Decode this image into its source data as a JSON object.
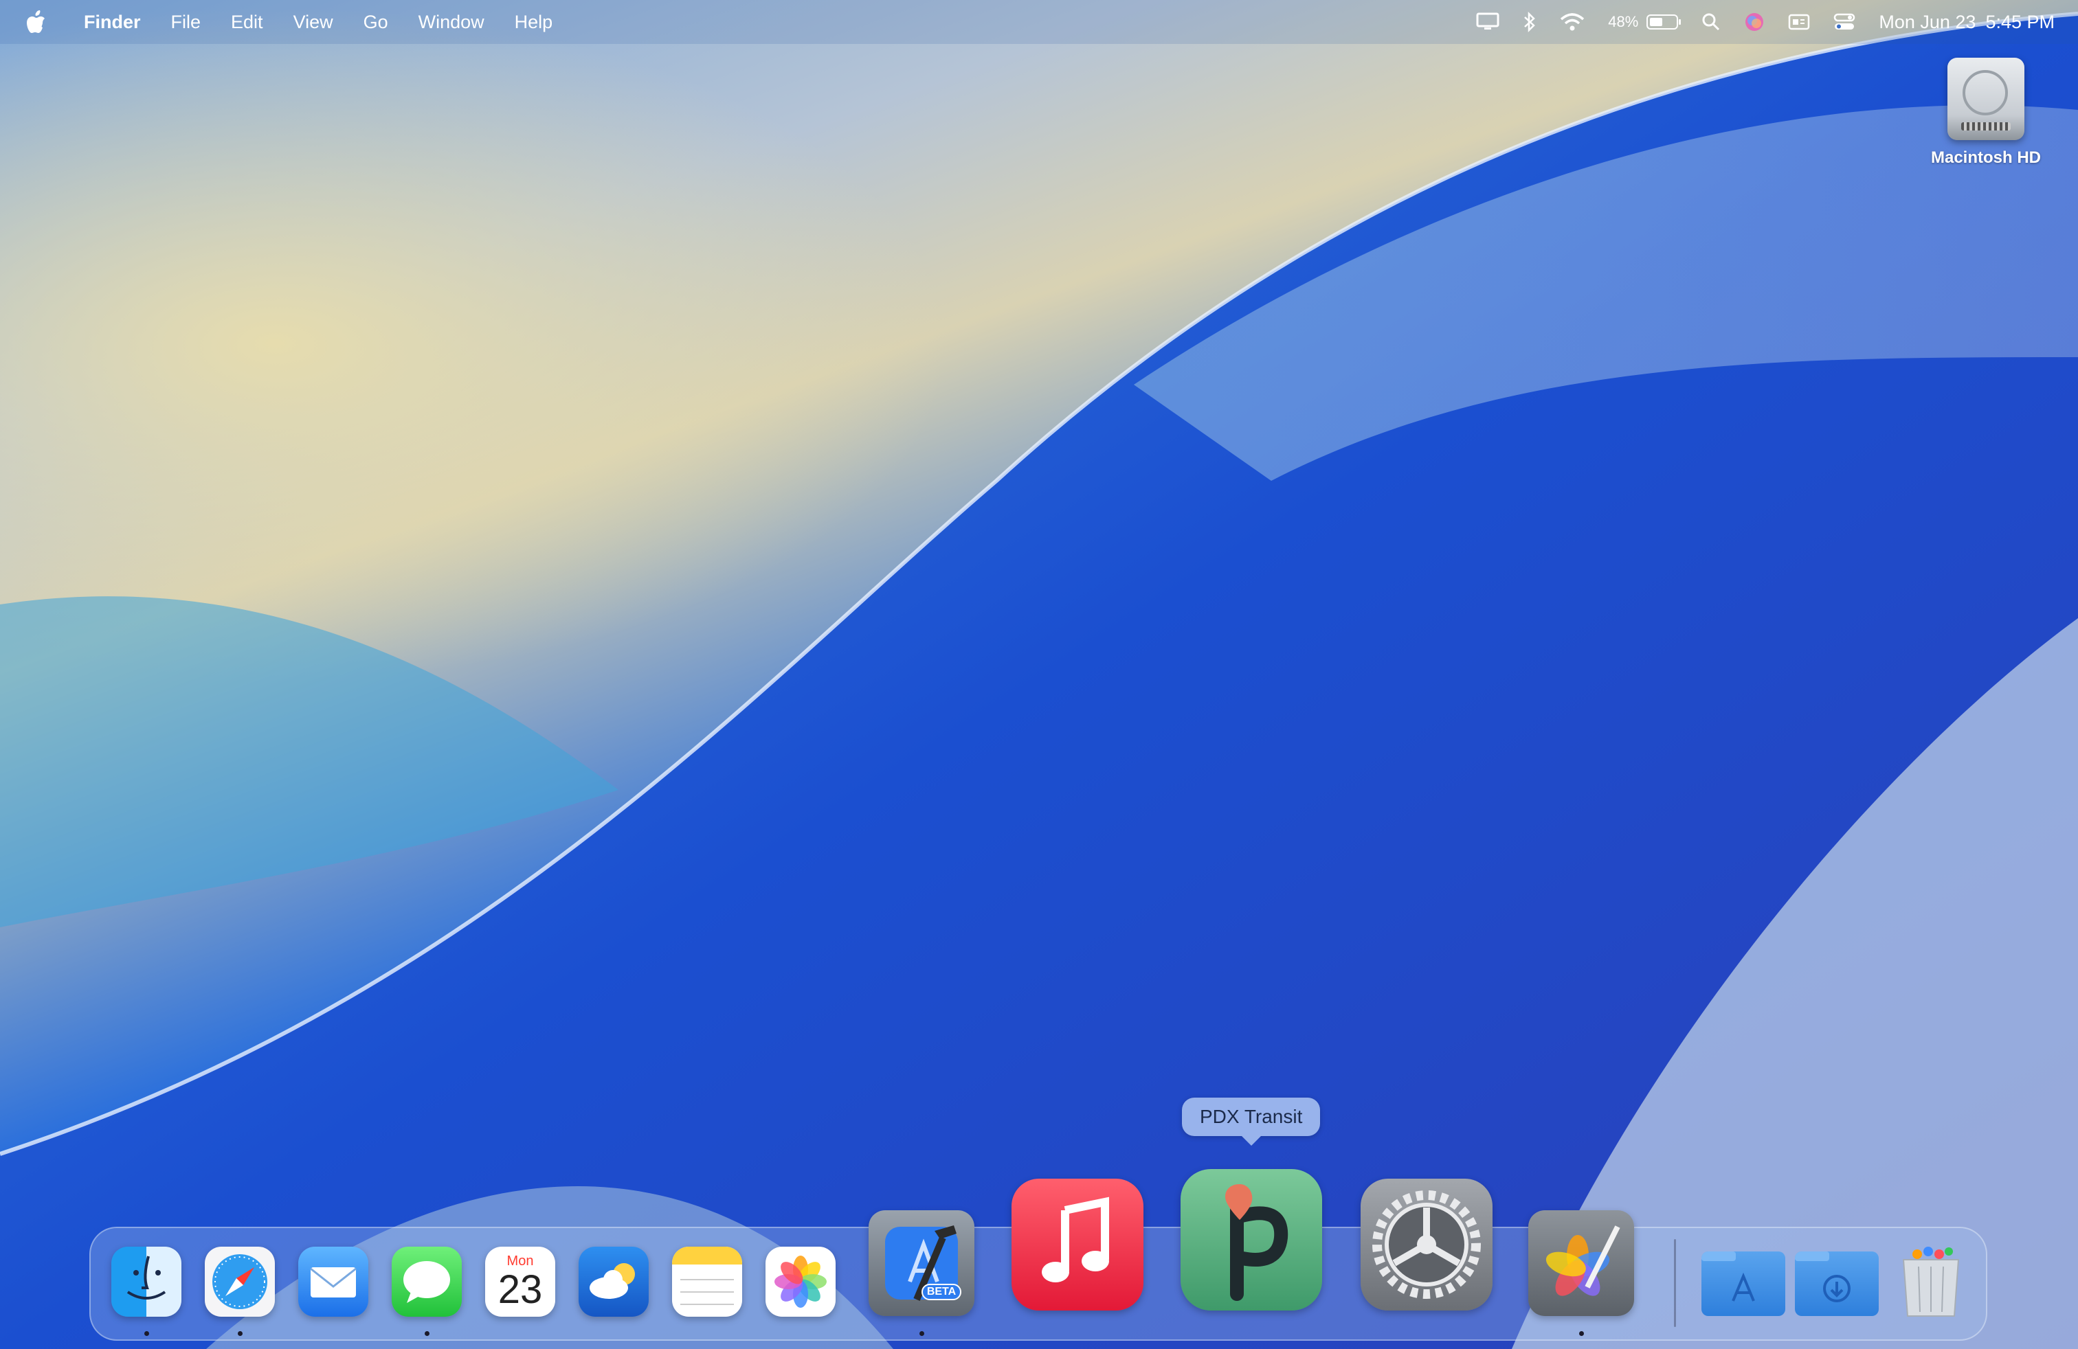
{
  "menubar": {
    "apple_icon": "apple-logo-icon",
    "app_name": "Finder",
    "menus": [
      "File",
      "Edit",
      "View",
      "Go",
      "Window",
      "Help"
    ],
    "status": {
      "icons": [
        "display-icon",
        "bluetooth-icon",
        "wifi-icon",
        "battery-icon",
        "search-icon",
        "siri-icon",
        "keyboard-input-icon",
        "control-center-icon"
      ],
      "battery_percent": "48%",
      "battery_level": 0.48,
      "date": "Mon Jun 23",
      "time": "5:45 PM"
    }
  },
  "desktop": {
    "items": [
      {
        "label": "Macintosh HD",
        "icon": "hard-drive-icon"
      }
    ]
  },
  "tooltip": {
    "label": "PDX Transit"
  },
  "dock": {
    "apps": [
      {
        "name": "Finder",
        "icon": "finder-icon",
        "running": true
      },
      {
        "name": "Safari",
        "icon": "safari-icon",
        "running": true
      },
      {
        "name": "Mail",
        "icon": "mail-icon",
        "running": false
      },
      {
        "name": "Messages",
        "icon": "messages-icon",
        "running": true
      },
      {
        "name": "Calendar",
        "icon": "calendar-icon",
        "running": false,
        "day": "Mon",
        "date": "23"
      },
      {
        "name": "Weather",
        "icon": "weather-icon",
        "running": false
      },
      {
        "name": "Notes",
        "icon": "notes-icon",
        "running": false
      },
      {
        "name": "Photos",
        "icon": "photos-icon",
        "running": false
      },
      {
        "name": "Xcode",
        "icon": "xcode-beta-icon",
        "running": true,
        "badge": "BETA"
      },
      {
        "name": "Music",
        "icon": "music-icon",
        "running": false
      },
      {
        "name": "PDX Transit",
        "icon": "pdx-transit-icon",
        "running": false
      },
      {
        "name": "System Settings",
        "icon": "system-settings-icon",
        "running": false
      },
      {
        "name": "Pixelmator Pro",
        "icon": "pixelmator-icon",
        "running": true
      }
    ],
    "folders": [
      {
        "name": "Applications",
        "icon": "applications-folder-icon"
      },
      {
        "name": "Downloads",
        "icon": "downloads-folder-icon"
      }
    ],
    "trash": {
      "name": "Trash",
      "icon": "trash-icon"
    }
  },
  "colors": {
    "accent": "#1746c4",
    "tooltip_bg": "#98b3ec"
  }
}
